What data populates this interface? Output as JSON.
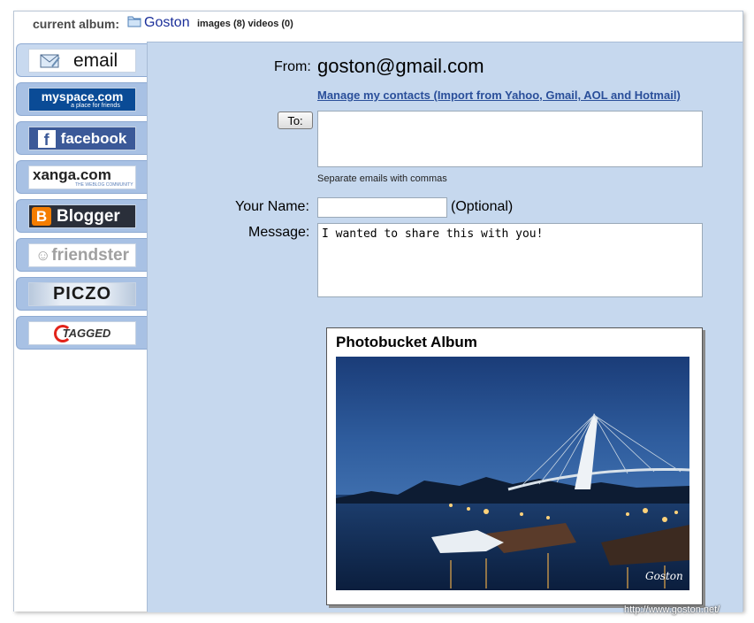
{
  "header": {
    "current_album_label": "current album:",
    "album_name": "Goston",
    "counts": "images (8) videos (0)"
  },
  "sidebar": {
    "tabs": [
      {
        "id": "email",
        "label": "email",
        "active": true
      },
      {
        "id": "myspace",
        "label": "myspace.com",
        "sub": "a place for friends"
      },
      {
        "id": "facebook",
        "label": "facebook"
      },
      {
        "id": "xanga",
        "label": "xanga.com",
        "sub": "THE WEBLOG COMMUNITY"
      },
      {
        "id": "blogger",
        "label": "Blogger"
      },
      {
        "id": "friendster",
        "label": "friendster"
      },
      {
        "id": "piczo",
        "label": "PICZO"
      },
      {
        "id": "tagged",
        "label": "TAGGED"
      }
    ]
  },
  "form": {
    "from_label": "From:",
    "from_value": "goston@gmail.com",
    "manage_link": "Manage my contacts (Import from Yahoo, Gmail, AOL and Hotmail)",
    "to_button": "To:",
    "to_hint": "Separate emails with commas",
    "name_label": "Your Name:",
    "name_optional": "(Optional)",
    "message_label": "Message:",
    "message_value": "I wanted to share this with you!"
  },
  "album_preview": {
    "title": "Photobucket Album",
    "photo_signature": "Goston"
  },
  "watermark": "http://www.goston.net/",
  "colors": {
    "main_bg": "#c6d8ee",
    "tab_bg": "#a8c1e4",
    "link": "#2a4f9a",
    "album_name": "#1b2f9a"
  }
}
